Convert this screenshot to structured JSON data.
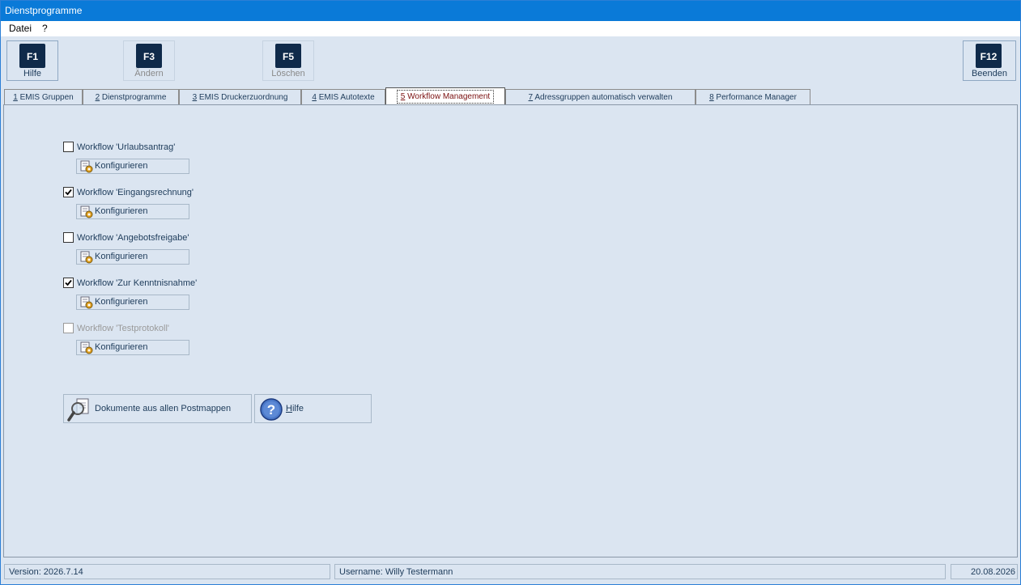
{
  "window": {
    "title": "Dienstprogramme"
  },
  "menu": [
    {
      "label": "Datei"
    },
    {
      "label": "?"
    }
  ],
  "toolbar": {
    "f1": {
      "key": "F1",
      "label": "Hilfe"
    },
    "f3": {
      "key": "F3",
      "label": "Ändern"
    },
    "f5": {
      "key": "F5",
      "label": "Löschen"
    },
    "f12": {
      "key": "F12",
      "label": "Beenden"
    }
  },
  "tabs": [
    {
      "num": "1",
      "label": " EMIS Gruppen"
    },
    {
      "num": "2",
      "label": " Dienstprogramme"
    },
    {
      "num": "3",
      "label": " EMIS Druckerzuordnung"
    },
    {
      "num": "4",
      "label": " EMIS Autotexte"
    },
    {
      "num": "5",
      "label": " Workflow Management"
    },
    {
      "num": "7",
      "label": " Adressgruppen automatisch verwalten"
    },
    {
      "num": "8",
      "label": " Performance Manager"
    }
  ],
  "workflows": [
    {
      "label": "Workflow 'Urlaubsantrag'",
      "checked": false,
      "enabled": true,
      "button": "Konfigurieren"
    },
    {
      "label": "Workflow 'Eingangsrechnung'",
      "checked": true,
      "enabled": true,
      "button": "Konfigurieren"
    },
    {
      "label": "Workflow 'Angebotsfreigabe'",
      "checked": false,
      "enabled": true,
      "button": "Konfigurieren"
    },
    {
      "label": "Workflow 'Zur Kenntnisnahme'",
      "checked": true,
      "enabled": true,
      "button": "Konfigurieren"
    },
    {
      "label": "Workflow 'Testprotokoll'",
      "checked": false,
      "enabled": false,
      "button": "Konfigurieren"
    }
  ],
  "actions": {
    "documents": "Dokumente aus allen Postmappen",
    "help_first": "H",
    "help_rest": "ilfe"
  },
  "status": {
    "version": "Version: 2026.7.14",
    "username": "Username: Willy Testermann",
    "date": "20.08.2026"
  }
}
